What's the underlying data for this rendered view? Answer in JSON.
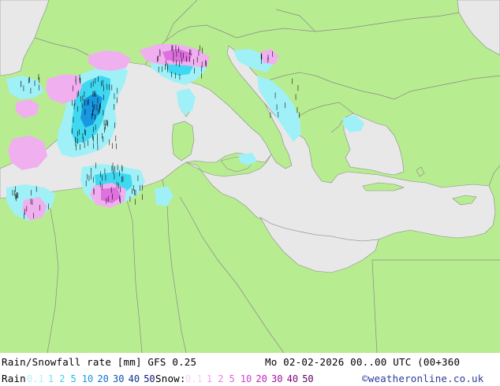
{
  "map": {
    "colors": {
      "land": "#b8ec90",
      "sea": "#e8e8e8",
      "border": "#8a8a8a",
      "rain_light": "#a0f0f8",
      "rain_mid": "#40d8f0",
      "snow_light": "#f0b0f0",
      "snow_mid": "#e070e0",
      "marker": "#000000"
    }
  },
  "footer": {
    "title": "Rain/Snowfall rate [mm] GFS 0.25",
    "datetime": "Mo 02-02-2026 00..00 UTC (00+360",
    "rain_label": "Rain",
    "rain_scale": [
      {
        "t": "0.1",
        "c": "#b0f0f8"
      },
      {
        "t": "1",
        "c": "#70e0f0"
      },
      {
        "t": "2",
        "c": "#40d0f0"
      },
      {
        "t": "5",
        "c": "#20b8e8"
      },
      {
        "t": "10",
        "c": "#1898e0"
      },
      {
        "t": "20",
        "c": "#1070d0"
      },
      {
        "t": "30",
        "c": "#1050b0"
      },
      {
        "t": "40",
        "c": "#103090"
      },
      {
        "t": "50",
        "c": "#101870"
      }
    ],
    "snow_label": "Snow:",
    "snow_scale": [
      {
        "t": "0.1",
        "c": "#f8d0f8"
      },
      {
        "t": "1",
        "c": "#f0a0f0"
      },
      {
        "t": "2",
        "c": "#e880e8"
      },
      {
        "t": "5",
        "c": "#e060e0"
      },
      {
        "t": "10",
        "c": "#d040d0"
      },
      {
        "t": "20",
        "c": "#c020c0"
      },
      {
        "t": "30",
        "c": "#a010a0"
      },
      {
        "t": "40",
        "c": "#800880"
      },
      {
        "t": "50",
        "c": "#600060"
      }
    ],
    "credit": "©weatheronline.co.uk"
  }
}
